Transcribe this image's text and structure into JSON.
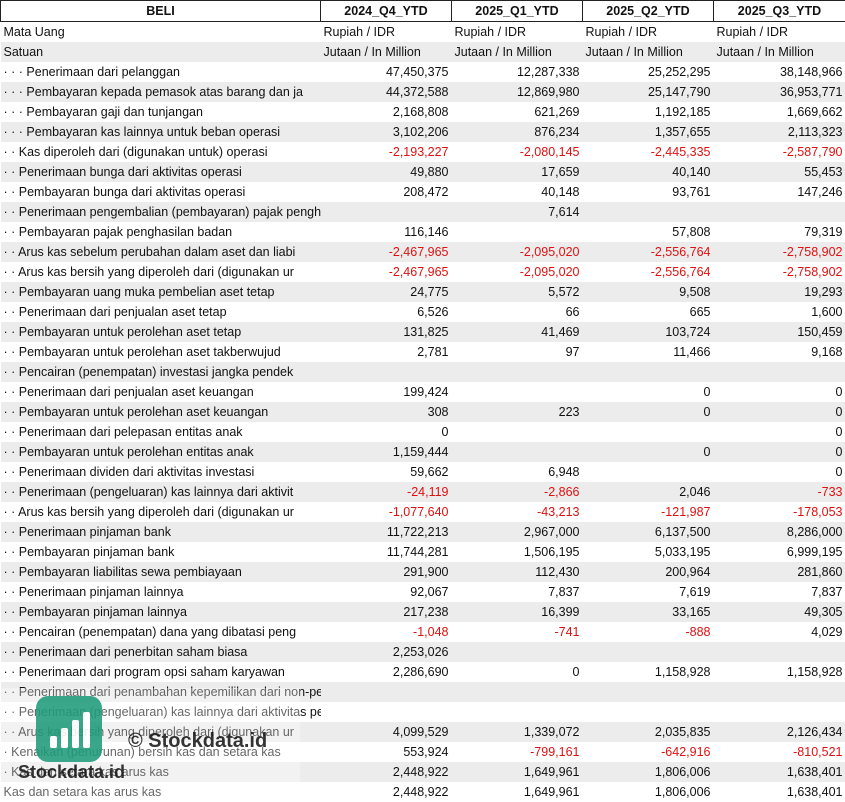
{
  "header": {
    "label_col": "BELI",
    "periods": [
      "2024_Q4_YTD",
      "2025_Q1_YTD",
      "2025_Q2_YTD",
      "2025_Q3_YTD"
    ]
  },
  "currency_row": {
    "label": "Mata Uang",
    "value": "Rupiah / IDR"
  },
  "unit_row": {
    "label": "Satuan",
    "value": "Jutaan / In Million"
  },
  "rows": [
    {
      "label": "· · · Penerimaan dari pelanggan",
      "v": [
        "47,450,375",
        "12,287,338",
        "25,252,295",
        "38,148,966"
      ]
    },
    {
      "label": "· · · Pembayaran kepada pemasok atas barang dan ja",
      "v": [
        "44,372,588",
        "12,869,980",
        "25,147,790",
        "36,953,771"
      ]
    },
    {
      "label": "· · · Pembayaran gaji dan tunjangan",
      "v": [
        "2,168,808",
        "621,269",
        "1,192,185",
        "1,669,662"
      ]
    },
    {
      "label": "· · · Pembayaran kas lainnya untuk beban operasi",
      "v": [
        "3,102,206",
        "876,234",
        "1,357,655",
        "2,113,323"
      ]
    },
    {
      "label": "· · Kas diperoleh dari (digunakan untuk) operasi",
      "v": [
        "-2,193,227",
        "-2,080,145",
        "-2,445,335",
        "-2,587,790"
      ]
    },
    {
      "label": "· · Penerimaan bunga dari aktivitas operasi",
      "v": [
        "49,880",
        "17,659",
        "40,140",
        "55,453"
      ]
    },
    {
      "label": "· · Pembayaran bunga dari aktivitas operasi",
      "v": [
        "208,472",
        "40,148",
        "93,761",
        "147,246"
      ]
    },
    {
      "label": "· · Penerimaan pengembalian (pembayaran) pajak penghasilan dari aktivi",
      "v": [
        "",
        "7,614",
        "",
        ""
      ]
    },
    {
      "label": "· · Pembayaran pajak penghasilan badan",
      "v": [
        "116,146",
        "",
        "57,808",
        "79,319"
      ]
    },
    {
      "label": "· · Arus kas sebelum perubahan dalam aset dan liabi",
      "v": [
        "-2,467,965",
        "-2,095,020",
        "-2,556,764",
        "-2,758,902"
      ]
    },
    {
      "label": "· · Arus kas bersih yang diperoleh dari (digunakan ur",
      "v": [
        "-2,467,965",
        "-2,095,020",
        "-2,556,764",
        "-2,758,902"
      ]
    },
    {
      "label": "· · Pembayaran uang muka pembelian aset tetap",
      "v": [
        "24,775",
        "5,572",
        "9,508",
        "19,293"
      ]
    },
    {
      "label": "· · Penerimaan dari penjualan aset tetap",
      "v": [
        "6,526",
        "66",
        "665",
        "1,600"
      ]
    },
    {
      "label": "· · Pembayaran untuk perolehan aset tetap",
      "v": [
        "131,825",
        "41,469",
        "103,724",
        "150,459"
      ]
    },
    {
      "label": "· · Pembayaran untuk perolehan aset takberwujud",
      "v": [
        "2,781",
        "97",
        "11,466",
        "9,168"
      ]
    },
    {
      "label": "· · Pencairan (penempatan) investasi jangka pendek",
      "v": [
        "",
        "",
        "",
        ""
      ]
    },
    {
      "label": "· · Penerimaan dari penjualan aset keuangan",
      "v": [
        "199,424",
        "",
        "0",
        "0"
      ]
    },
    {
      "label": "· · Pembayaran untuk perolehan aset keuangan",
      "v": [
        "308",
        "223",
        "0",
        "0"
      ]
    },
    {
      "label": "· · Penerimaan dari pelepasan entitas anak",
      "v": [
        "0",
        "",
        "",
        "0"
      ]
    },
    {
      "label": "· · Pembayaran untuk perolehan entitas anak",
      "v": [
        "1,159,444",
        "",
        "0",
        "0"
      ]
    },
    {
      "label": "· · Penerimaan dividen dari aktivitas investasi",
      "v": [
        "59,662",
        "6,948",
        "",
        "0"
      ]
    },
    {
      "label": "· · Penerimaan (pengeluaran) kas lainnya dari aktivit",
      "v": [
        "-24,119",
        "-2,866",
        "2,046",
        "-733"
      ]
    },
    {
      "label": "· · Arus kas bersih yang diperoleh dari (digunakan ur",
      "v": [
        "-1,077,640",
        "-43,213",
        "-121,987",
        "-178,053"
      ]
    },
    {
      "label": "· · Penerimaan pinjaman bank",
      "v": [
        "11,722,213",
        "2,967,000",
        "6,137,500",
        "8,286,000"
      ]
    },
    {
      "label": "· · Pembayaran pinjaman bank",
      "v": [
        "11,744,281",
        "1,506,195",
        "5,033,195",
        "6,999,195"
      ]
    },
    {
      "label": "· · Pembayaran liabilitas sewa pembiayaan",
      "v": [
        "291,900",
        "112,430",
        "200,964",
        "281,860"
      ]
    },
    {
      "label": "· · Penerimaan pinjaman lainnya",
      "v": [
        "92,067",
        "7,837",
        "7,619",
        "7,837"
      ]
    },
    {
      "label": "· · Pembayaran pinjaman lainnya",
      "v": [
        "217,238",
        "16,399",
        "33,165",
        "49,305"
      ]
    },
    {
      "label": "· · Pencairan (penempatan) dana yang dibatasi peng",
      "v": [
        "-1,048",
        "-741",
        "-888",
        "4,029"
      ]
    },
    {
      "label": "· · Penerimaan dari penerbitan saham biasa",
      "v": [
        "2,253,026",
        "",
        "",
        ""
      ]
    },
    {
      "label": "· · Penerimaan dari program opsi saham karyawan",
      "v": [
        "2,286,690",
        "0",
        "1,158,928",
        "1,158,928"
      ]
    },
    {
      "label": "· · Penerimaan dari penambahan kepemilikan dari non-pengendali",
      "v": [
        "",
        "",
        "",
        ""
      ]
    },
    {
      "label": "· · Penerimaan (pengeluaran) kas lainnya dari aktivitas pendanaan",
      "v": [
        "",
        "",
        "",
        ""
      ]
    },
    {
      "label": "· · Arus kas bersih yang diperoleh dari (digunakan ur",
      "v": [
        "4,099,529",
        "1,339,072",
        "2,035,835",
        "2,126,434"
      ]
    },
    {
      "label": "· Kenaikan (penurunan) bersih kas dan setara kas",
      "v": [
        "553,924",
        "-799,161",
        "-642,916",
        "-810,521"
      ]
    },
    {
      "label": "· Kas dan setara kas arus kas",
      "v": [
        "2,448,922",
        "1,649,961",
        "1,806,006",
        "1,638,401"
      ]
    },
    {
      "label": "Kas dan setara kas arus kas",
      "v": [
        "2,448,922",
        "1,649,961",
        "1,806,006",
        "1,638,401"
      ]
    }
  ],
  "watermark": {
    "copyright": "© Stockdata.id",
    "brand": "Stockdata.id",
    "icon": "bar-chart-icon",
    "color": "#1f9a7a"
  },
  "colors": {
    "negative": "#e01010",
    "stripe": "#ececec"
  }
}
